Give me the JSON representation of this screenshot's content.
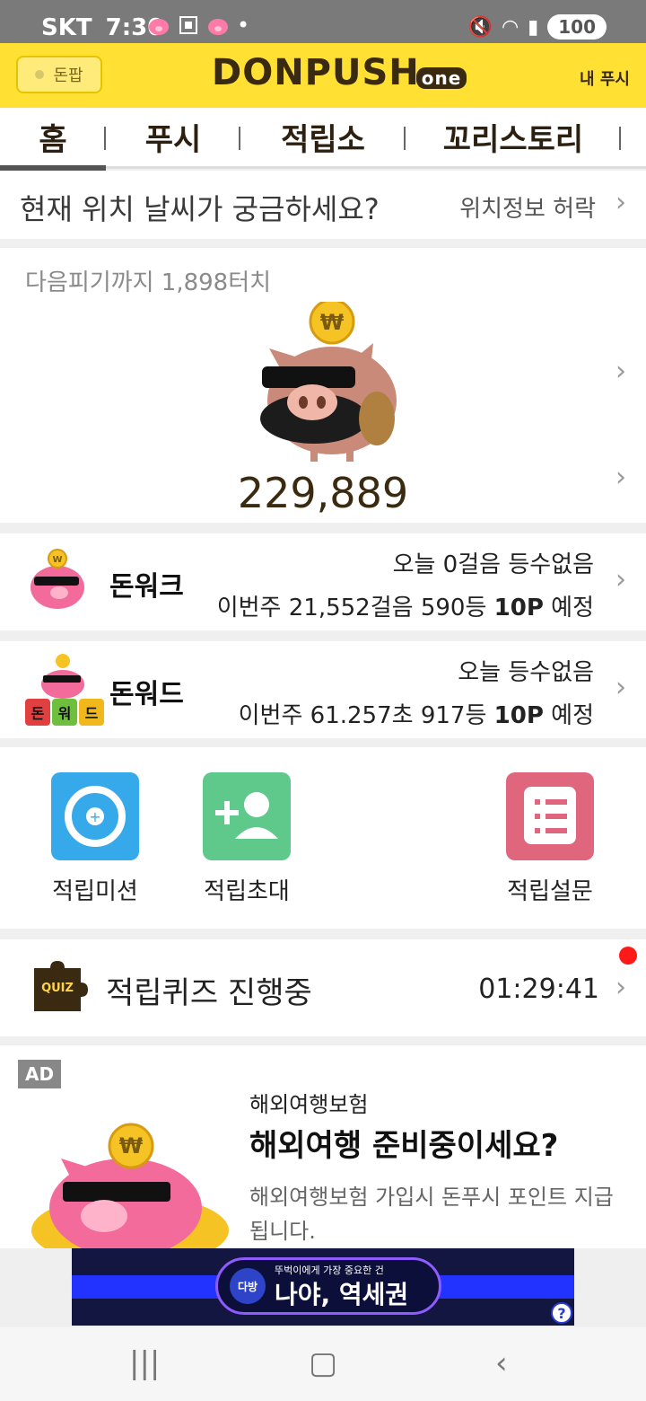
{
  "status_bar": {
    "carrier": "SKT",
    "time": "7:30",
    "battery": "100"
  },
  "header": {
    "donpop_label": "돈팝",
    "logo": "DONPUSH",
    "logo_suffix": "one",
    "my_push": "내 푸시"
  },
  "tabs": [
    {
      "label": "홈"
    },
    {
      "label": "푸시"
    },
    {
      "label": "적립소"
    },
    {
      "label": "꼬리스토리"
    }
  ],
  "weather": {
    "question": "현재 위치 날씨가 궁금하세요?",
    "permission": "위치정보 허락"
  },
  "piggy": {
    "next_text": "다음피기까지 1,898터치",
    "points": "229,889"
  },
  "donwalk": {
    "title": "돈워크",
    "today": "오늘 0걸음 등수없음",
    "week_prefix": "이번주 21,552걸음 590등 ",
    "week_points": "10P",
    "week_suffix": " 예정"
  },
  "donword": {
    "title": "돈워드",
    "tiles": [
      "돈",
      "워",
      "드"
    ],
    "today": "오늘 등수없음",
    "week_prefix": "이번주 61.257초 917등 ",
    "week_points": "10P",
    "week_suffix": " 예정"
  },
  "shortcuts": [
    {
      "label": "적립미션",
      "color": "#35a9ea"
    },
    {
      "label": "적립초대",
      "color": "#5ec98a"
    },
    {
      "label": "적립설문",
      "color": "#e0667d"
    }
  ],
  "quiz": {
    "icon_text": "QUIZ",
    "title": "적립퀴즈 진행중",
    "timer": "01:29:41"
  },
  "ad": {
    "badge": "AD",
    "category": "해외여행보험",
    "headline": "해외여행 준비중이세요?",
    "description": "해외여행보험 가입시 돈푸시 포인트 지급됩니다."
  },
  "banner": {
    "logo_text": "다방",
    "small_text": "뚜벅이에게 가장 중요한 건",
    "big_text": "나야, 역세권",
    "help": "?"
  },
  "colors": {
    "header_yellow": "#ffe033",
    "brown": "#3b2a12"
  }
}
